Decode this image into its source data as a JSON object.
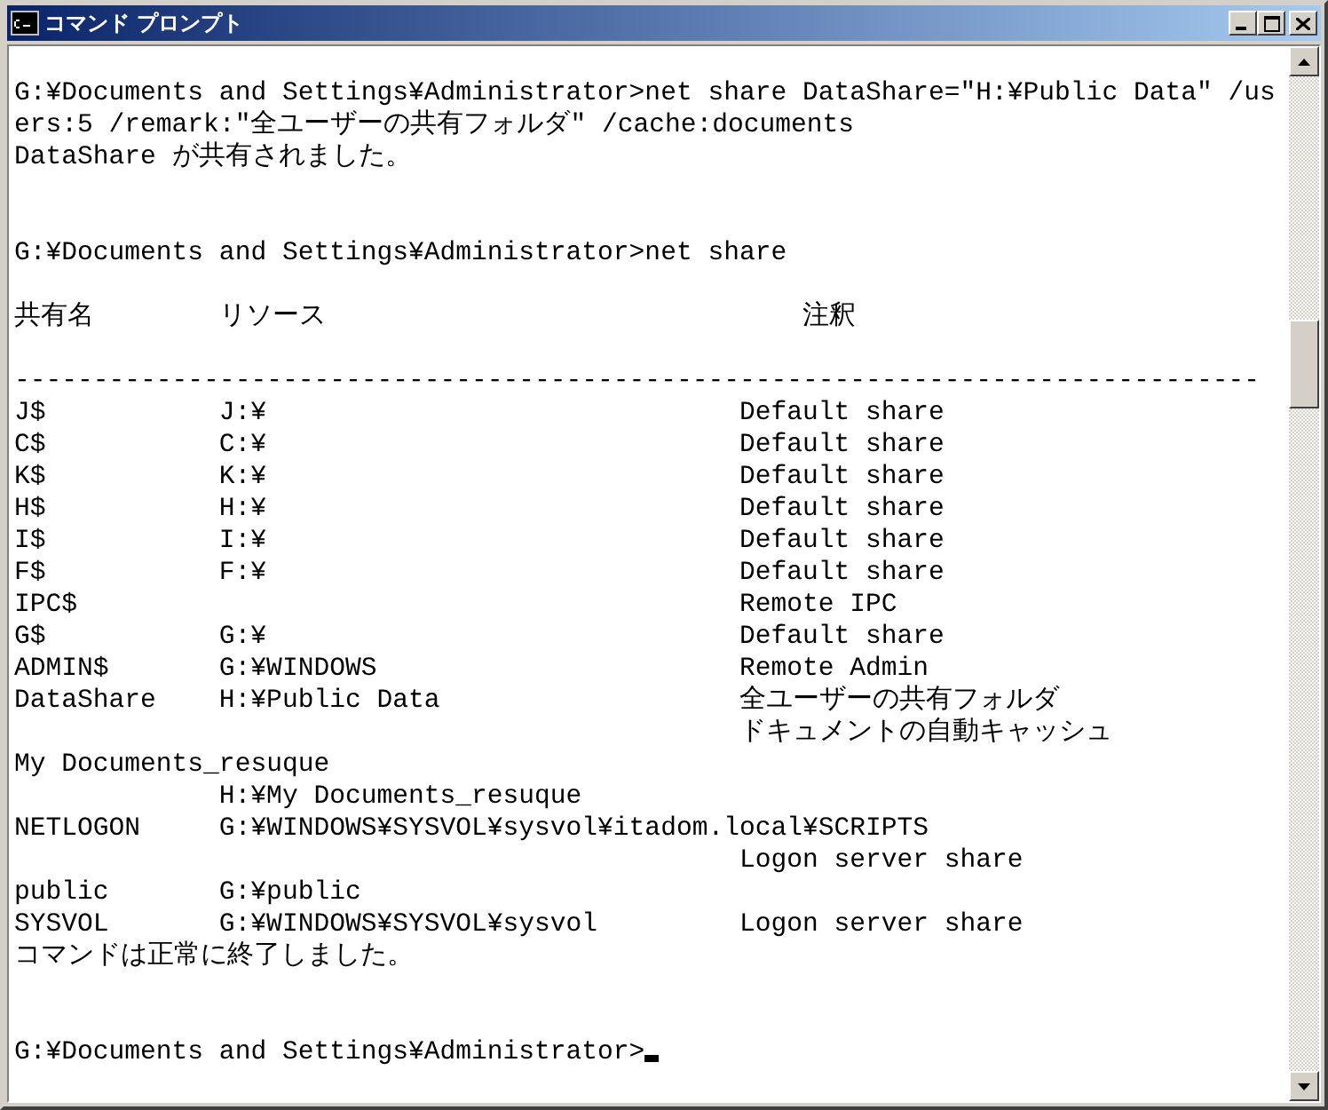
{
  "window": {
    "title": "コマンド プロンプト"
  },
  "console": {
    "lines": [
      {
        "kind": "text",
        "text": "G:¥Documents and Settings¥Administrator>net share DataShare=\"H:¥Public Data\" /us"
      },
      {
        "kind": "text",
        "text": "ers:5 /remark:\"全ユーザーの共有フォルダ\" /cache:documents"
      },
      {
        "kind": "text",
        "text": "DataShare が共有されました。"
      },
      {
        "kind": "blank"
      },
      {
        "kind": "blank"
      },
      {
        "kind": "text",
        "text": "G:¥Documents and Settings¥Administrator>net share"
      },
      {
        "kind": "blank"
      },
      {
        "kind": "header",
        "share_name": "共有名",
        "resource": "リソース",
        "remark": "注釈"
      },
      {
        "kind": "blank"
      },
      {
        "kind": "rule",
        "text": "-------------------------------------------------------------------------------"
      },
      {
        "kind": "row",
        "share_name": "J$",
        "resource": "J:¥",
        "remark": "Default share"
      },
      {
        "kind": "row",
        "share_name": "C$",
        "resource": "C:¥",
        "remark": "Default share"
      },
      {
        "kind": "row",
        "share_name": "K$",
        "resource": "K:¥",
        "remark": "Default share"
      },
      {
        "kind": "row",
        "share_name": "H$",
        "resource": "H:¥",
        "remark": "Default share"
      },
      {
        "kind": "row",
        "share_name": "I$",
        "resource": "I:¥",
        "remark": "Default share"
      },
      {
        "kind": "row",
        "share_name": "F$",
        "resource": "F:¥",
        "remark": "Default share"
      },
      {
        "kind": "row",
        "share_name": "IPC$",
        "remark": "Remote IPC"
      },
      {
        "kind": "row",
        "share_name": "G$",
        "resource": "G:¥",
        "remark": "Default share"
      },
      {
        "kind": "row",
        "share_name": "ADMIN$",
        "resource": "G:¥WINDOWS",
        "remark": "Remote Admin"
      },
      {
        "kind": "row",
        "share_name": "DataShare",
        "resource": "H:¥Public Data",
        "remark": "全ユーザーの共有フォルダ"
      },
      {
        "kind": "row",
        "remark": "ドキュメントの自動キャッシュ"
      },
      {
        "kind": "text",
        "text": "My Documents_resuque"
      },
      {
        "kind": "row",
        "resource": "H:¥My Documents_resuque"
      },
      {
        "kind": "text",
        "text": "NETLOGON     G:¥WINDOWS¥SYSVOL¥sysvol¥itadom.local¥SCRIPTS"
      },
      {
        "kind": "row",
        "remark": "Logon server share"
      },
      {
        "kind": "row",
        "share_name": "public",
        "resource": "G:¥public"
      },
      {
        "kind": "row",
        "share_name": "SYSVOL",
        "resource": "G:¥WINDOWS¥SYSVOL¥sysvol",
        "remark": "Logon server share"
      },
      {
        "kind": "text",
        "text": "コマンドは正常に終了しました。"
      },
      {
        "kind": "blank"
      },
      {
        "kind": "blank"
      },
      {
        "kind": "prompt",
        "text": "G:¥Documents and Settings¥Administrator>"
      }
    ]
  }
}
